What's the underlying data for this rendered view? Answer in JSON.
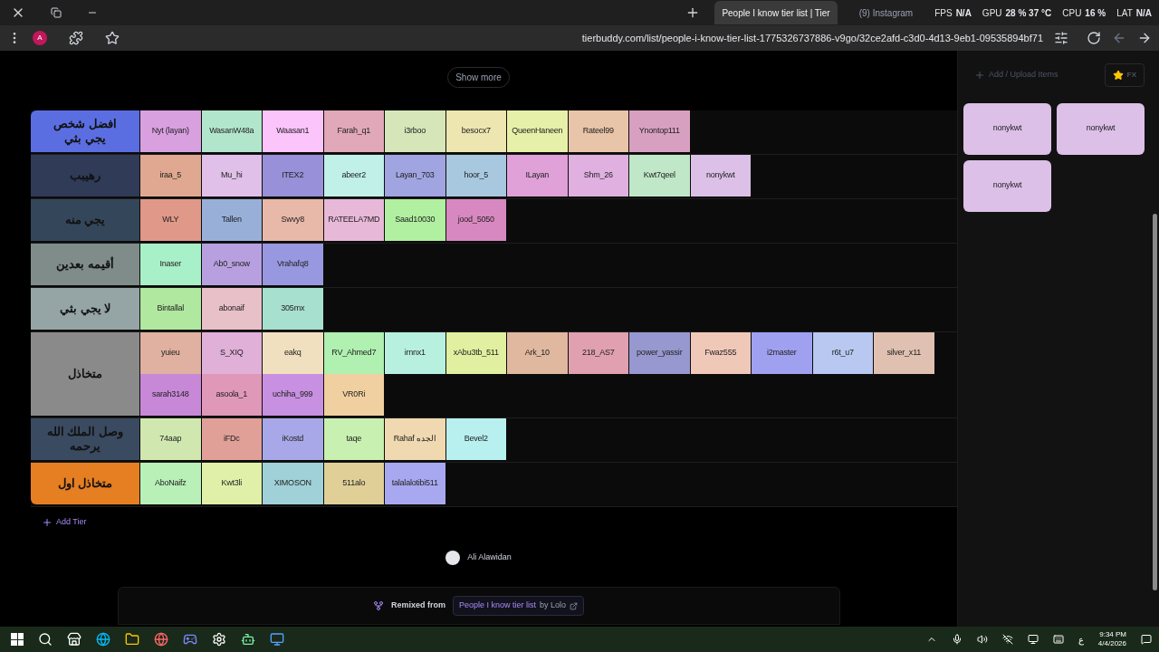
{
  "browser": {
    "tabs": [
      {
        "title": "People I know tier list | Tier",
        "selected": true
      },
      {
        "title": "(9) Instagram",
        "selected": false
      }
    ],
    "overlay": [
      {
        "label": "FPS",
        "value": "N/A"
      },
      {
        "label": "GPU",
        "value": "28 % 37 °C"
      },
      {
        "label": "CPU",
        "value": "16 %"
      },
      {
        "label": "LAT",
        "value": "N/A"
      }
    ],
    "profile_initial": "A",
    "url": "tierbuddy.com/list/people-i-know-tier-list-1775326737886-v9go/32ce2afd-c3d0-4d13-9eb1-09535894bf71"
  },
  "show_more": "Show more",
  "tiers": [
    {
      "label": "افضل شخص يجي بثي",
      "color": "#5b6ee1",
      "items": [
        {
          "name": "Nyt (layan)",
          "color": "#d9a0e0"
        },
        {
          "name": "WasanW48a",
          "color": "#b2e6cc"
        },
        {
          "name": "Waasan1",
          "color": "#fbc4fb"
        },
        {
          "name": "Farah_q1",
          "color": "#e0a8b8"
        },
        {
          "name": "i3rboo",
          "color": "#d6e6b8"
        },
        {
          "name": "besocx7",
          "color": "#ede6b0"
        },
        {
          "name": "QueenHaneen",
          "color": "#e6f0a8"
        },
        {
          "name": "Rateel99",
          "color": "#e8c4a8"
        },
        {
          "name": "Ynontop111",
          "color": "#d8a0c0"
        }
      ]
    },
    {
      "label": "رهيبب",
      "color": "#2f3b57",
      "items": [
        {
          "name": "iraa_5",
          "color": "#e0a890"
        },
        {
          "name": "Mu_hi",
          "color": "#e0c0e8"
        },
        {
          "name": "ITEX2",
          "color": "#9890d8"
        },
        {
          "name": "abeer2",
          "color": "#c0f0e8"
        },
        {
          "name": "Layan_703",
          "color": "#a0a4e0"
        },
        {
          "name": "hoor_5",
          "color": "#a8c8e0"
        },
        {
          "name": "ILayan",
          "color": "#e0a0d8"
        },
        {
          "name": "Shm_26",
          "color": "#e0b0e0"
        },
        {
          "name": "Kwt7qeel",
          "color": "#c0e8c8"
        },
        {
          "name": "nonykwt",
          "color": "#dcc0e8"
        }
      ]
    },
    {
      "label": "يجي منه",
      "color": "#34475a",
      "items": [
        {
          "name": "WLY",
          "color": "#e09888"
        },
        {
          "name": "Tallen",
          "color": "#98b0d8"
        },
        {
          "name": "Swvy8",
          "color": "#e8b8a8"
        },
        {
          "name": "RATEELA7MD",
          "color": "#e8b8d8"
        },
        {
          "name": "Saad10030",
          "color": "#b0f0a0"
        },
        {
          "name": "jood_5050",
          "color": "#d888c0"
        }
      ]
    },
    {
      "label": "أقيمه بعدين",
      "color": "#7f8c8a",
      "items": [
        {
          "name": "Inaser",
          "color": "#a8f0c8"
        },
        {
          "name": "Ab0_snow",
          "color": "#b8a0e0"
        },
        {
          "name": "Vrahafq8",
          "color": "#9898e0"
        }
      ]
    },
    {
      "label": "لا يجي بثي",
      "color": "#95a5a6",
      "items": [
        {
          "name": "Bintallal",
          "color": "#b0e8a0"
        },
        {
          "name": "abonaif",
          "color": "#e8c0c8"
        },
        {
          "name": "305mx",
          "color": "#a8e0d0"
        }
      ]
    },
    {
      "label": "متخاذل",
      "color": "#8a8a8a",
      "items": [
        {
          "name": "yuieu",
          "color": "#e0b0a0"
        },
        {
          "name": "S_XIQ",
          "color": "#e0b0d8"
        },
        {
          "name": "eakq",
          "color": "#f0e0c0"
        },
        {
          "name": "RV_Ahmed7",
          "color": "#b0f0b0"
        },
        {
          "name": "irnnx1",
          "color": "#b8f0e0"
        },
        {
          "name": "xAbu3tb_511",
          "color": "#e0f0a0"
        },
        {
          "name": "Ark_10",
          "color": "#e0b8a0"
        },
        {
          "name": "218_AS7",
          "color": "#e0a0b0"
        },
        {
          "name": "power_yassir",
          "color": "#9898d0"
        },
        {
          "name": "Fwaz555",
          "color": "#f0c8b8"
        },
        {
          "name": "i2master",
          "color": "#a0a0f0"
        },
        {
          "name": "r6t_u7",
          "color": "#b8c8f0"
        },
        {
          "name": "silver_x11",
          "color": "#e0c0b0"
        },
        {
          "name": "sarah3148",
          "color": "#c888d8"
        },
        {
          "name": "asoola_1",
          "color": "#e098b8"
        },
        {
          "name": "uchiha_999",
          "color": "#c890e0"
        },
        {
          "name": "VR0Ri",
          "color": "#f0d0a0"
        }
      ]
    },
    {
      "label": "وصل الملك الله يرحمه",
      "color": "#3a4a60",
      "items": [
        {
          "name": "74aap",
          "color": "#d0e8b0"
        },
        {
          "name": "iFDc",
          "color": "#e0a098"
        },
        {
          "name": "iKostd",
          "color": "#a8a8e8"
        },
        {
          "name": "taqe",
          "color": "#c8f0b0"
        },
        {
          "name": "Rahaf الجده",
          "color": "#f0d8b0"
        },
        {
          "name": "Bevel2",
          "color": "#b8f0f0"
        }
      ]
    },
    {
      "label": "متخاذل اول",
      "color": "#e67e22",
      "items": [
        {
          "name": "AboNaifz",
          "color": "#b8f0b8"
        },
        {
          "name": "Kwt3li",
          "color": "#e0f0a8"
        },
        {
          "name": "XIMOSON",
          "color": "#a0d0d8"
        },
        {
          "name": "511alo",
          "color": "#e0d098"
        },
        {
          "name": "talalalotibi511",
          "color": "#a8a8f0"
        }
      ]
    }
  ],
  "add_tier": "Add Tier",
  "author": "Ali Alawidan",
  "remix": {
    "label": "Remixed from",
    "link": "People I know tier list",
    "by": "by Lolo"
  },
  "sidebar": {
    "upload": "Add / Upload Items",
    "fx": "FX",
    "items": [
      {
        "name": "nonykwt",
        "color": "#dcc0e8"
      },
      {
        "name": "nonykwt",
        "color": "#dcc0e8"
      },
      {
        "name": "nonykwt",
        "color": "#dcc0e8"
      }
    ]
  },
  "taskbar": {
    "language": "ع",
    "time": "9:34 PM",
    "date": "4/4/2026"
  }
}
